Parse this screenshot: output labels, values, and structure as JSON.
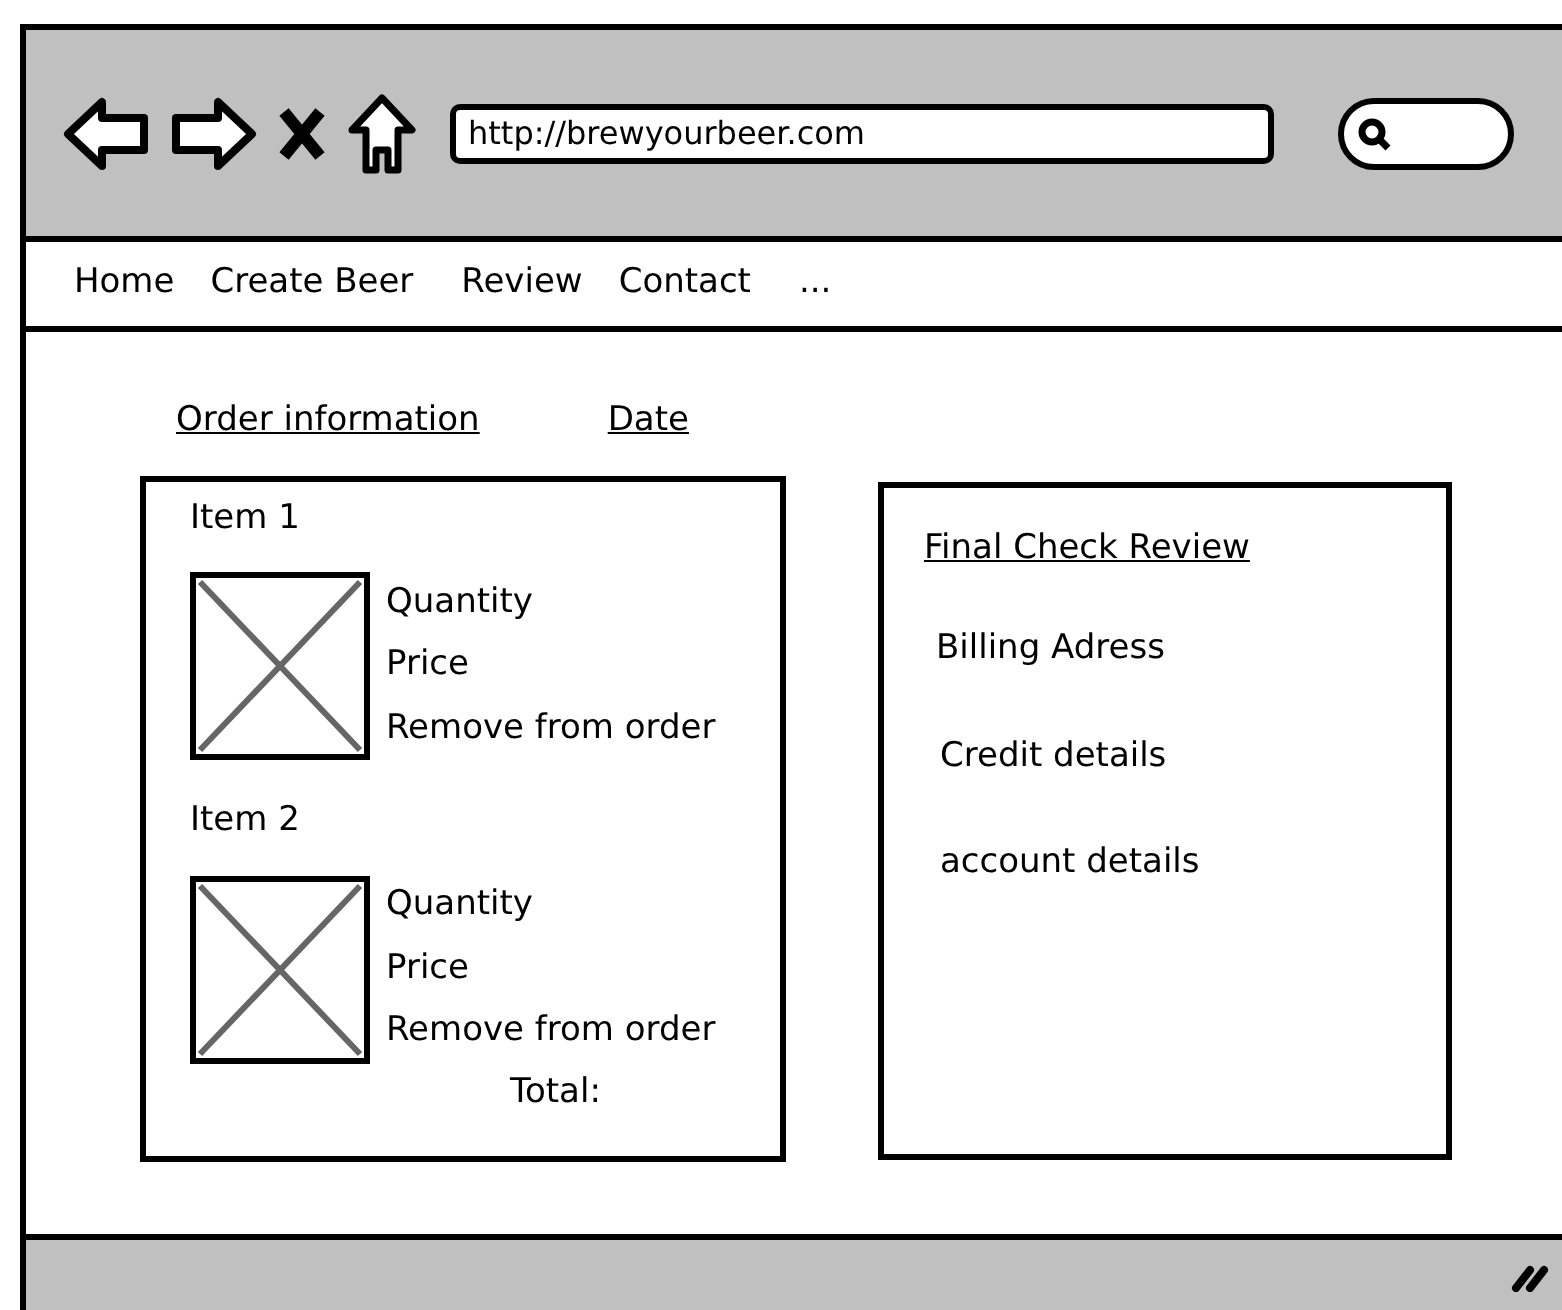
{
  "browser": {
    "address": "http://brewyourbeer.com"
  },
  "nav": [
    "Home",
    "Create Beer",
    "Review",
    "Contact",
    "..."
  ],
  "order": {
    "heading": "Order information",
    "date": "Date",
    "items": [
      {
        "title": "Item 1",
        "fields": [
          "Quantity",
          "Price",
          "Remove from order"
        ]
      },
      {
        "title": "Item 2",
        "fields": [
          "Quantity",
          "Price",
          "Remove from order"
        ]
      }
    ],
    "total": "Total:"
  },
  "review": {
    "title": "Final Check Review",
    "lines": [
      "Billing Adress",
      "Credit details",
      "account details"
    ]
  }
}
